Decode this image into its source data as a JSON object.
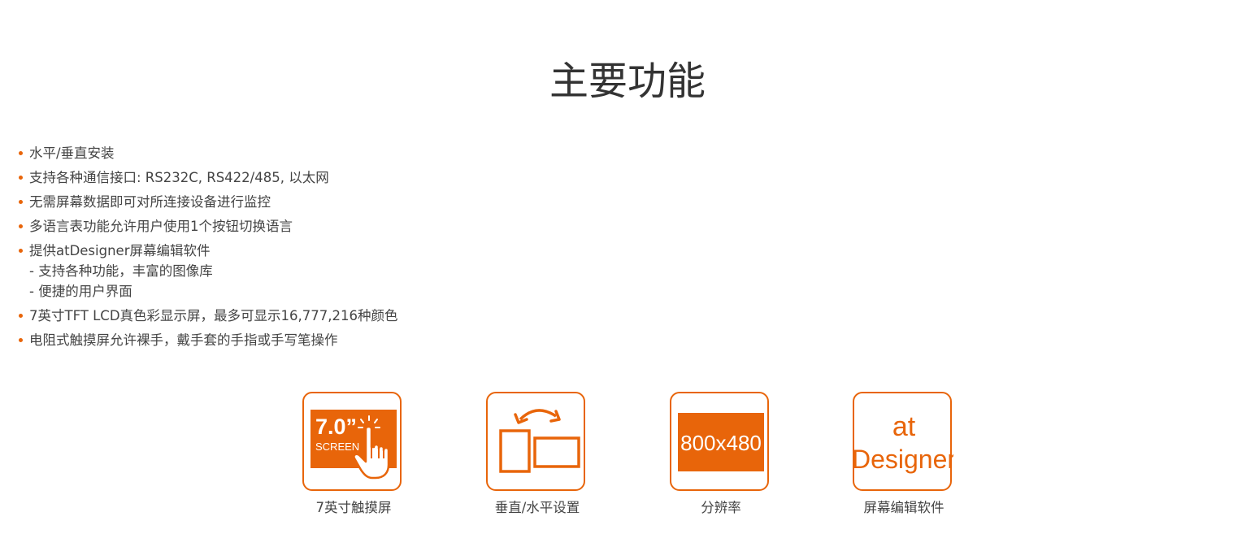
{
  "page": {
    "title": "主要功能"
  },
  "features": [
    {
      "text": "水平/垂直安装"
    },
    {
      "text": "支持各种通信接口: RS232C, RS422/485, 以太网"
    },
    {
      "text": "无需屏幕数据即可对所连接设备进行监控"
    },
    {
      "text": "多语言表功能允许用户使用1个按钮切换语言"
    },
    {
      "text": "提供atDesigner屏幕编辑软件",
      "sub": [
        "- 支持各种功能，丰富的图像库",
        "- 便捷的用户界面"
      ]
    },
    {
      "text": "7英寸TFT LCD真色彩显示屏，最多可显示16,777,216种颜色"
    },
    {
      "text": "电阻式触摸屏允许裸手，戴手套的手指或手写笔操作"
    }
  ],
  "icons": [
    {
      "caption": "7英寸触摸屏",
      "icon": "touch-screen-icon",
      "screen_size": "7.0”",
      "screen_label": "SCREEN"
    },
    {
      "caption": "垂直/水平设置",
      "icon": "rotate-orientation-icon"
    },
    {
      "caption": "分辨率",
      "icon": "resolution-icon",
      "resolution": "800x480"
    },
    {
      "caption": "屏幕编辑软件",
      "icon": "atdesigner-logo-icon",
      "logo_line1": "at",
      "logo_line2": "Designer"
    }
  ],
  "colors": {
    "accent": "#e8650a",
    "text": "#444444",
    "title": "#333333"
  }
}
